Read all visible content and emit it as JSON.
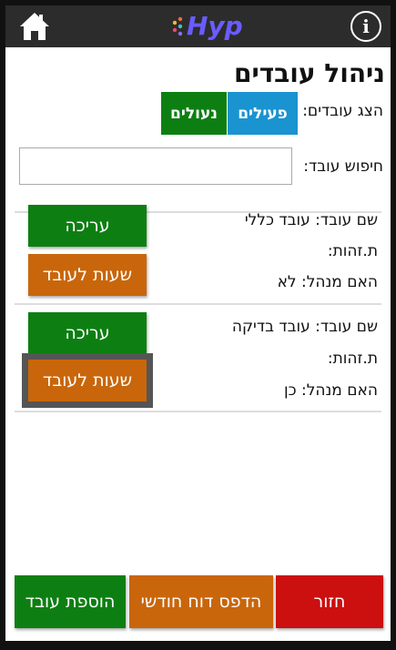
{
  "header": {
    "logo_text": "Hyp",
    "info_label": "i",
    "icons": {
      "home": "home-icon",
      "info": "info-icon",
      "logo": "hyp-logo"
    },
    "colors": {
      "bar": "#2c2c2c",
      "logo": "#6a5cff"
    }
  },
  "page": {
    "title": "ניהול עובדים",
    "filter_label": "הצג עובדים:",
    "filter_active": "פעילים",
    "filter_cancelled": "נעולים",
    "search_label": "חיפוש עובד:",
    "search_value": "",
    "search_placeholder": ""
  },
  "employees": [
    {
      "name": "שם עובד: עובד כללי",
      "id": "ת.זהות:",
      "manager": "האם מנהל: לא",
      "edit": "עריכה",
      "hours": "שעות לעובד"
    },
    {
      "name": "שם עובד: עובד בדיקה",
      "id": "ת.זהות:",
      "manager": "האם מנהל: כן",
      "edit": "עריכה",
      "hours": "שעות לעובד"
    }
  ],
  "footer": {
    "back": "חזור",
    "print_report": "הדפס דוח חודשי",
    "add_employee": "הוספת עובד"
  },
  "colors": {
    "green": "#0d7f12",
    "blue": "#1a93d1",
    "orange": "#c9660b",
    "red": "#cc0f0f"
  }
}
